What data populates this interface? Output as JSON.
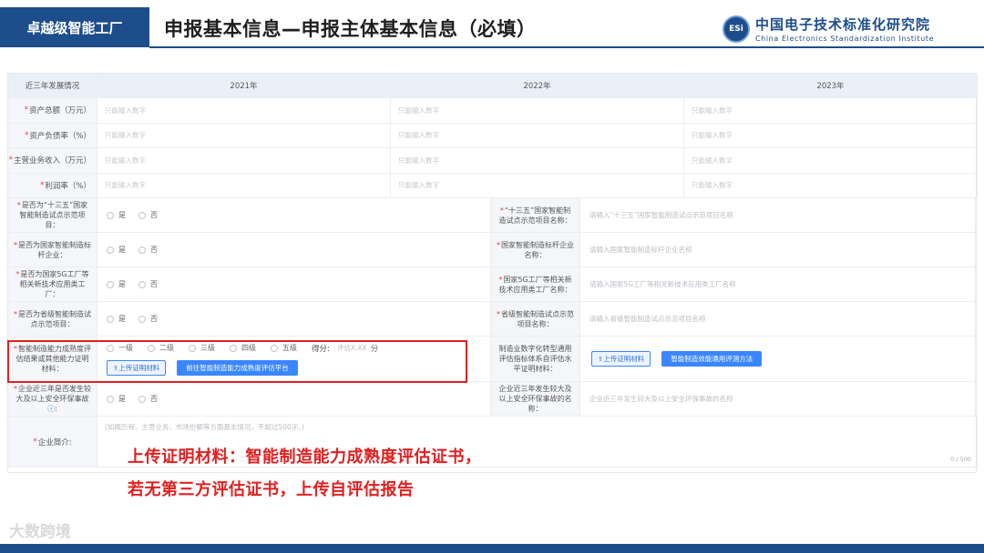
{
  "slide": {
    "tag": "卓越级智能工厂",
    "title": "申报基本信息—申报主体基本信息（必填）",
    "logo_mark": "ESi",
    "logo_cn": "中国电子技术标准化研究院",
    "logo_en": "China Electronics Standardization Institute"
  },
  "table": {
    "headers": [
      "近三年发展情况",
      "2021年",
      "2022年",
      "2023年"
    ],
    "rows": [
      {
        "label": "资产总额（万元）",
        "required": "*",
        "placeholders": [
          "只能输入数字",
          "只能输入数字",
          "只能输入数字"
        ]
      },
      {
        "label": "资产负债率（%）",
        "required": "*",
        "placeholders": [
          "只能输入数字",
          "只能输入数字",
          "只能输入数字"
        ]
      },
      {
        "label": "主营业务收入（万元）",
        "required": "*",
        "placeholders": [
          "只能输入数字",
          "只能输入数字",
          "只能输入数字"
        ]
      },
      {
        "label": "利润率（%）",
        "required": "*",
        "placeholders": [
          "只能输入数字",
          "只能输入数字",
          "只能输入数字"
        ]
      }
    ]
  },
  "options": {
    "yes": "是",
    "no": "否"
  },
  "mid_rows": [
    {
      "left_label": "是否为“十三五”国家智能制造试点示范项目：",
      "right_label": "“十三五”国家智能制造试点示范项目名称：",
      "right_placeholder": "请输入“十三五”国家智能制造试点示范项目名称"
    },
    {
      "left_label": "是否为国家智能制造标杆企业：",
      "right_label": "国家智能制造标杆企业名称：",
      "right_placeholder": "请输入国家智能制造标杆企业名称"
    },
    {
      "left_label": "是否为国家5G工厂等相关新技术应用类工厂：",
      "right_label": "国家5G工厂等相关新技术应用类工厂名称：",
      "right_placeholder": "请输入国家5G工厂等相关新技术应用类工厂名称"
    },
    {
      "left_label": "是否为省级智能制造试点示范项目：",
      "right_label": "省级智能制造试点示范项目名称：",
      "right_placeholder": "请输入省级智能制造试点示范项目名称"
    }
  ],
  "maturity": {
    "label": "智能制造能力成熟度评估结果或其他能力证明材料：",
    "levels": [
      "一级",
      "二级",
      "三级",
      "四级",
      "五级"
    ],
    "score_label": "得分:",
    "score_placeholder": "评估X.XX",
    "score_unit": "分",
    "upload_btn": "上传证明材料",
    "platform_btn": "前往智能制造能力成熟度评估平台",
    "right_label": "制造业数字化转型通用评估指标体系自评估水平证明材料：",
    "right_upload_btn": "上传证明材料",
    "right_method_btn": "智能制造效能通用评测方法"
  },
  "safety": {
    "left_label": "企业近三年是否发生较大及以上安全环保事故",
    "right_label": "企业近三年发生较大及以上安全环保事故的名称：",
    "right_placeholder": "企业近三年发生较大及以上安全环保事故的名称"
  },
  "intro": {
    "label": "企业简介:",
    "placeholder": "(如概历程、主营业务、市场份额等方面基本情况，不超过500字。)",
    "counter": "0 / 500"
  },
  "notes": [
    "上传证明材料：智能制造能力成熟度评估证书，",
    "若无第三方评估证书，上传自评估报告"
  ],
  "watermark": "大数跨境",
  "colors": {
    "brand": "#1d4d8a",
    "accent": "#3a86ff",
    "highlight": "#e02020"
  }
}
